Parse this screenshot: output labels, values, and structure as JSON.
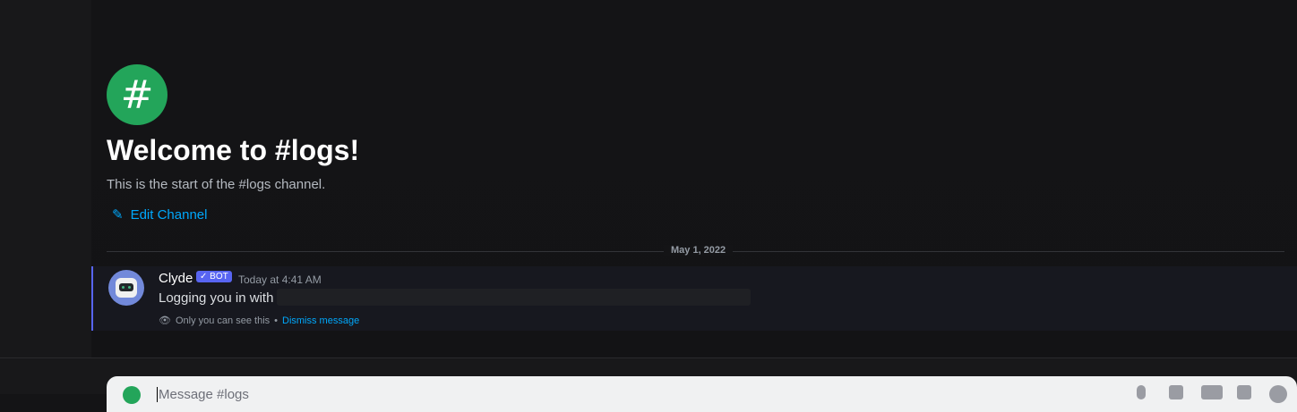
{
  "welcome": {
    "title": "Welcome to #logs!",
    "subtitle": "This is the start of the #logs channel.",
    "edit_label": "Edit Channel"
  },
  "date_divider": "May 1, 2022",
  "message": {
    "author": "Clyde",
    "badge": "✓ BOT",
    "timestamp": "Today at 4:41 AM",
    "text": "Logging you in with",
    "ephemeral_note": "Only you can see this",
    "separator": "•",
    "dismiss_label": "Dismiss message"
  },
  "composer": {
    "placeholder": "Message #logs"
  }
}
